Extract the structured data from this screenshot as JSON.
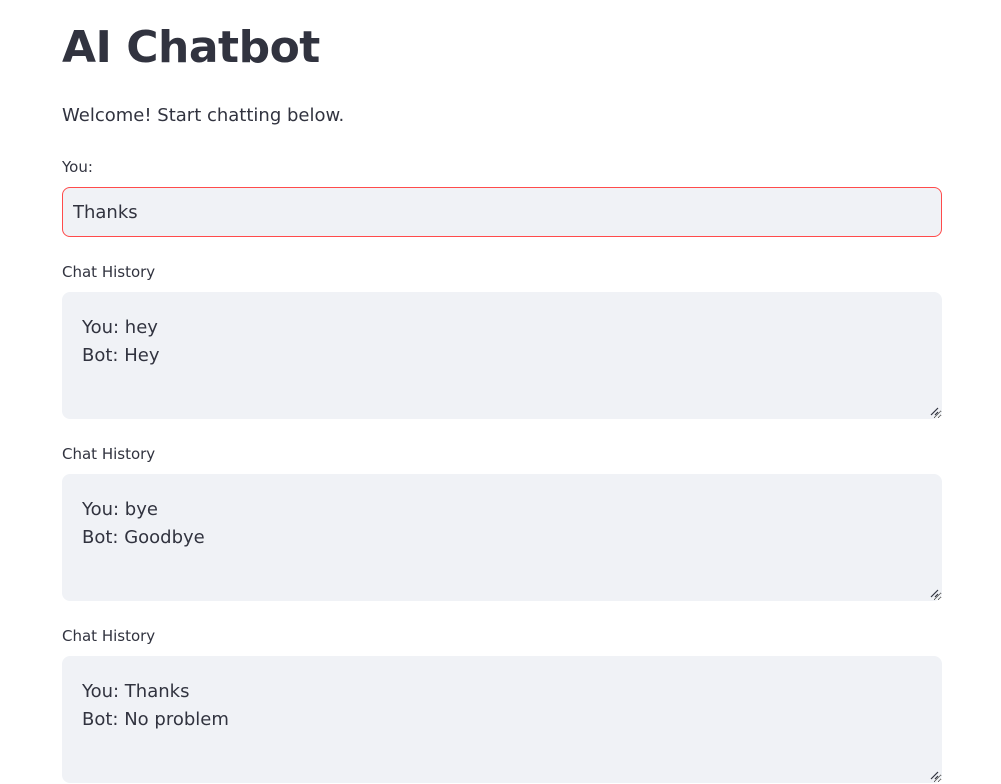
{
  "page": {
    "title": "AI Chatbot",
    "welcome": "Welcome! Start chatting below."
  },
  "input": {
    "label": "You:",
    "value": "Thanks"
  },
  "histories": [
    {
      "label": "Chat History",
      "lines": [
        "You: hey",
        "Bot: Hey"
      ]
    },
    {
      "label": "Chat History",
      "lines": [
        "You: bye",
        "Bot: Goodbye"
      ]
    },
    {
      "label": "Chat History",
      "lines": [
        "You: Thanks",
        "Bot: No problem"
      ]
    }
  ],
  "colors": {
    "accent": "#ff4b4b",
    "field_bg": "#f0f2f6",
    "text": "#31333f"
  }
}
